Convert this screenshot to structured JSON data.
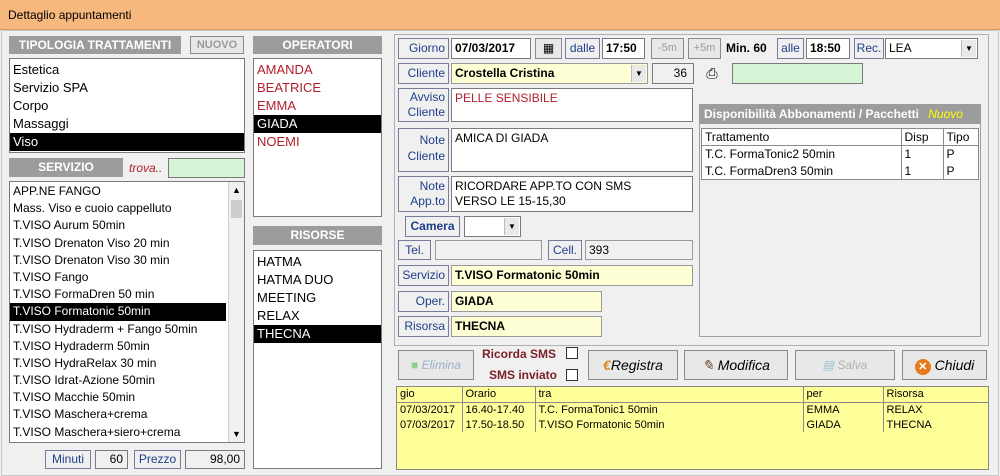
{
  "window": {
    "title": "Dettaglio appuntamenti"
  },
  "tipologia": {
    "header": "TIPOLOGIA TRATTAMENTI",
    "new_label": "NUOVO",
    "items": [
      "Estetica",
      "Servizio SPA",
      "Corpo",
      "Massaggi",
      "Viso"
    ],
    "selected": "Viso"
  },
  "servizio": {
    "header": "SERVIZIO",
    "search_label": "trova..",
    "search_value": "",
    "items": [
      "APP.NE FANGO",
      "Mass. Viso e cuoio cappelluto",
      "T.VISO Aurum 50min",
      "T.VISO Drenaton Viso 20 min",
      "T.VISO Drenaton Viso 30 min",
      "T.VISO Fango",
      "T.VISO FormaDren 50 min",
      "T.VISO Formatonic 50min",
      "T.VISO Hydraderm + Fango 50min",
      "T.VISO Hydraderm 50min",
      "T.VISO HydraRelax 30 min",
      "T.VISO Idrat-Azione 50min",
      "T.VISO Macchie 50min",
      "T.VISO Maschera+crema",
      "T.VISO Maschera+siero+crema"
    ],
    "selected": "T.VISO Formatonic 50min"
  },
  "bottom": {
    "minuti_label": "Minuti",
    "minuti_value": "60",
    "prezzo_label": "Prezzo",
    "prezzo_value": "98,00"
  },
  "operatori": {
    "header": "OPERATORI",
    "items": [
      "AMANDA",
      "BEATRICE",
      "EMMA",
      "GIADA",
      "NOEMI"
    ],
    "selected": "GIADA"
  },
  "risorse": {
    "header": "RISORSE",
    "items": [
      "HATMA",
      "HATMA DUO",
      "MEETING",
      "RELAX",
      "THECNA"
    ],
    "selected": "THECNA"
  },
  "form": {
    "giorno_label": "Giorno",
    "giorno_value": "07/03/2017",
    "dalle_label": "dalle",
    "dalle_value": "17:50",
    "minus5": "-5m",
    "plus5": "+5m",
    "min_label": "Min. 60",
    "alle_label": "alle",
    "alle_value": "18:50",
    "rec_label": "Rec.",
    "rec_value": "LEA",
    "cliente_label": "Cliente",
    "cliente_value": "Crostella Cristina",
    "cliente_num": "36",
    "avviso_label": "Avviso Cliente",
    "avviso_l1": "Avviso",
    "avviso_l2": "Cliente",
    "avviso_value": "PELLE SENSIBILE",
    "note_cliente_l1": "Note",
    "note_cliente_l2": "Cliente",
    "note_cliente_value": "AMICA DI GIADA",
    "note_app_l1": "Note",
    "note_app_l2": "App.to",
    "note_app_value1": "RICORDARE APP.TO CON SMS",
    "note_app_value2": "VERSO LE 15-15,30",
    "camera_label": "Camera",
    "tel_label": "Tel.",
    "tel_value": "",
    "cell_label": "Cell.",
    "cell_value": "393",
    "servizio_label": "Servizio",
    "servizio_value": "T.VISO Formatonic 50min",
    "oper_label": "Oper.",
    "oper_value": "GIADA",
    "risorsa_label": "Risorsa",
    "risorsa_value": "THECNA"
  },
  "abbonamenti": {
    "header": "Disponibilità Abbonamenti / Pacchetti",
    "new_label": "Nuovo",
    "columns": [
      "Trattamento",
      "Disp",
      "Tipo"
    ],
    "rows": [
      [
        "T.C. FormaTonic2 50min",
        "1",
        "P"
      ],
      [
        "T.C. FormaDren3 50min",
        "1",
        "P"
      ]
    ]
  },
  "actions": {
    "elimina": "Elimina",
    "ricorda_sms": "Ricorda SMS",
    "sms_inviato": "SMS inviato",
    "registra": "Registra",
    "modifica": "Modifica",
    "salva": "Salva",
    "chiudi": "Chiudi"
  },
  "appointments": {
    "columns": [
      "gio",
      "Orario",
      "tra",
      "per",
      "Risorsa"
    ],
    "rows": [
      [
        "07/03/2017",
        "16.40-17.40",
        "T.C. FormaTonic1 50min",
        "EMMA",
        "RELAX"
      ],
      [
        "07/03/2017",
        "17.50-18.50",
        "T.VISO Formatonic 50min",
        "GIADA",
        "THECNA"
      ]
    ]
  },
  "colors": {
    "titlebar": "#f7b87e",
    "header_grey": "#9c9c9c",
    "label_blue": "#1f3d8a",
    "yellow_panel": "#ffff99",
    "green_field": "#d6f5d6",
    "nuovo_yellow": "#ffff00"
  }
}
